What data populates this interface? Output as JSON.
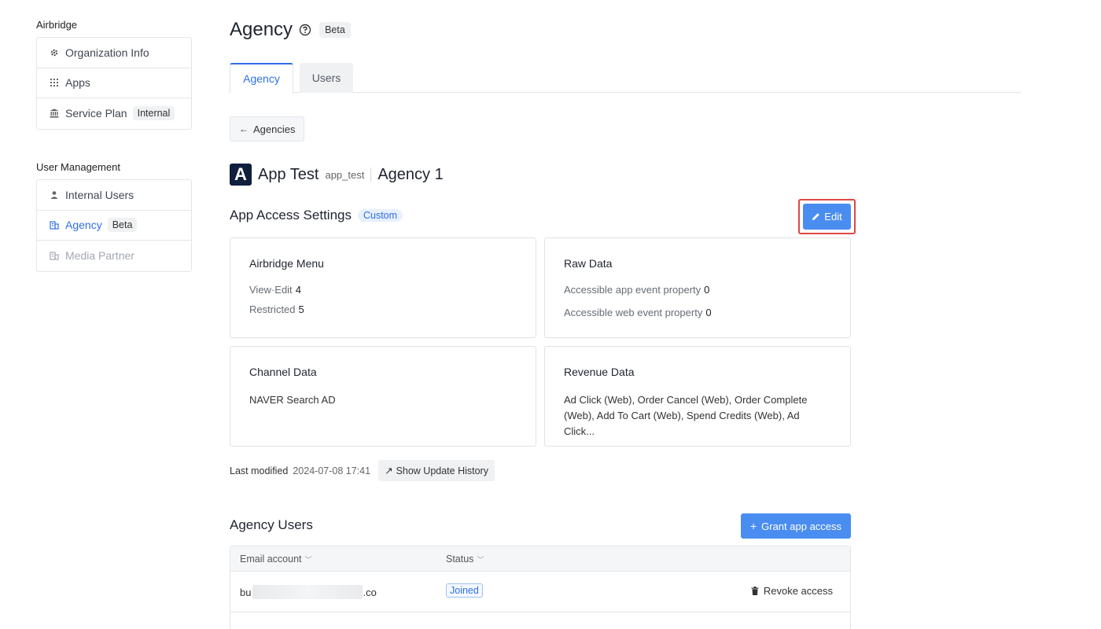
{
  "sidebar": {
    "section1_title": "Airbridge",
    "section1_items": [
      {
        "label": "Organization Info",
        "icon": "gear-icon"
      },
      {
        "label": "Apps",
        "icon": "grid-icon"
      },
      {
        "label": "Service Plan",
        "icon": "bank-icon",
        "badge": "Internal"
      }
    ],
    "section2_title": "User Management",
    "section2_items": [
      {
        "label": "Internal Users",
        "icon": "person-icon"
      },
      {
        "label": "Agency",
        "icon": "building-icon",
        "badge": "Beta",
        "active": true
      },
      {
        "label": "Media Partner",
        "icon": "building-icon",
        "disabled": true
      }
    ]
  },
  "header": {
    "title": "Agency",
    "badge": "Beta",
    "tabs": [
      {
        "label": "Agency",
        "active": true
      },
      {
        "label": "Users"
      }
    ]
  },
  "back_button": "Agencies",
  "app": {
    "logo_letter": "A",
    "name": "App Test",
    "id": "app_test",
    "agency": "Agency 1"
  },
  "access_settings": {
    "title": "App Access Settings",
    "badge": "Custom",
    "edit_label": "Edit",
    "cards": {
      "menu": {
        "title": "Airbridge Menu",
        "view_edit_label": "View·Edit",
        "view_edit_value": "4",
        "restricted_label": "Restricted",
        "restricted_value": "5"
      },
      "raw": {
        "title": "Raw Data",
        "app_prop_label": "Accessible app event property",
        "app_prop_value": "0",
        "web_prop_label": "Accessible web event property",
        "web_prop_value": "0"
      },
      "channel": {
        "title": "Channel Data",
        "text": "NAVER Search AD"
      },
      "revenue": {
        "title": "Revenue Data",
        "text": "Ad Click (Web), Order Cancel (Web), Order Complete (Web), Add To Cart (Web), Spend Credits (Web), Ad Click..."
      }
    },
    "last_modified_label": "Last modified",
    "last_modified_value": "2024-07-08 17:41",
    "history_label": "Show Update History"
  },
  "agency_users": {
    "title": "Agency Users",
    "grant_label": "Grant app access",
    "columns": [
      "Email account",
      "Status"
    ],
    "rows": [
      {
        "email_prefix": "bu",
        "email_suffix": ".co",
        "status": "Joined",
        "action": "Revoke access"
      }
    ]
  },
  "colors": {
    "accent": "#2f6fe8",
    "button": "#4a8df0",
    "highlight": "#e04646"
  }
}
